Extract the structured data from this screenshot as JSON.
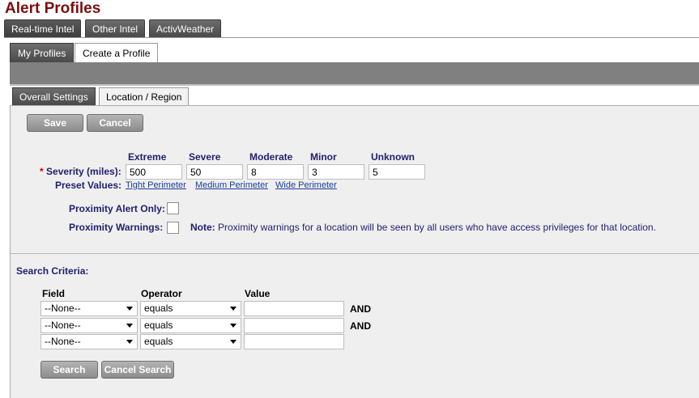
{
  "page_title": "Alert Profiles",
  "top_tabs": [
    "Real-time Intel",
    "Other Intel",
    "ActivWeather"
  ],
  "sub_tabs": [
    "My Profiles",
    "Create a Profile"
  ],
  "panel_tabs": [
    "Overall Settings",
    "Location / Region"
  ],
  "buttons": {
    "save": "Save",
    "cancel": "Cancel",
    "search": "Search",
    "cancel_search": "Cancel Search"
  },
  "severity": {
    "required_mark": "*",
    "label": "Severity (miles):",
    "columns": [
      "Extreme",
      "Severe",
      "Moderate",
      "Minor",
      "Unknown"
    ],
    "values": [
      "500",
      "50",
      "8",
      "3",
      "5"
    ]
  },
  "preset": {
    "label": "Preset Values:",
    "links": [
      "Tight Perimeter",
      "Medium Perimeter",
      "Wide Perimeter"
    ]
  },
  "proximity": {
    "alert_only_label": "Proximity Alert Only:",
    "warnings_label": "Proximity Warnings:",
    "note_bold": "Note:",
    "note_text": " Proximity warnings for a location will be seen by all users who have access privileges for that location."
  },
  "search_criteria": {
    "title": "Search Criteria:",
    "headers": {
      "field": "Field",
      "operator": "Operator",
      "value": "Value"
    },
    "rows": [
      {
        "field": "--None--",
        "operator": "equals",
        "value": "",
        "conj": "AND"
      },
      {
        "field": "--None--",
        "operator": "equals",
        "value": "",
        "conj": "AND"
      },
      {
        "field": "--None--",
        "operator": "equals",
        "value": "",
        "conj": ""
      }
    ]
  }
}
